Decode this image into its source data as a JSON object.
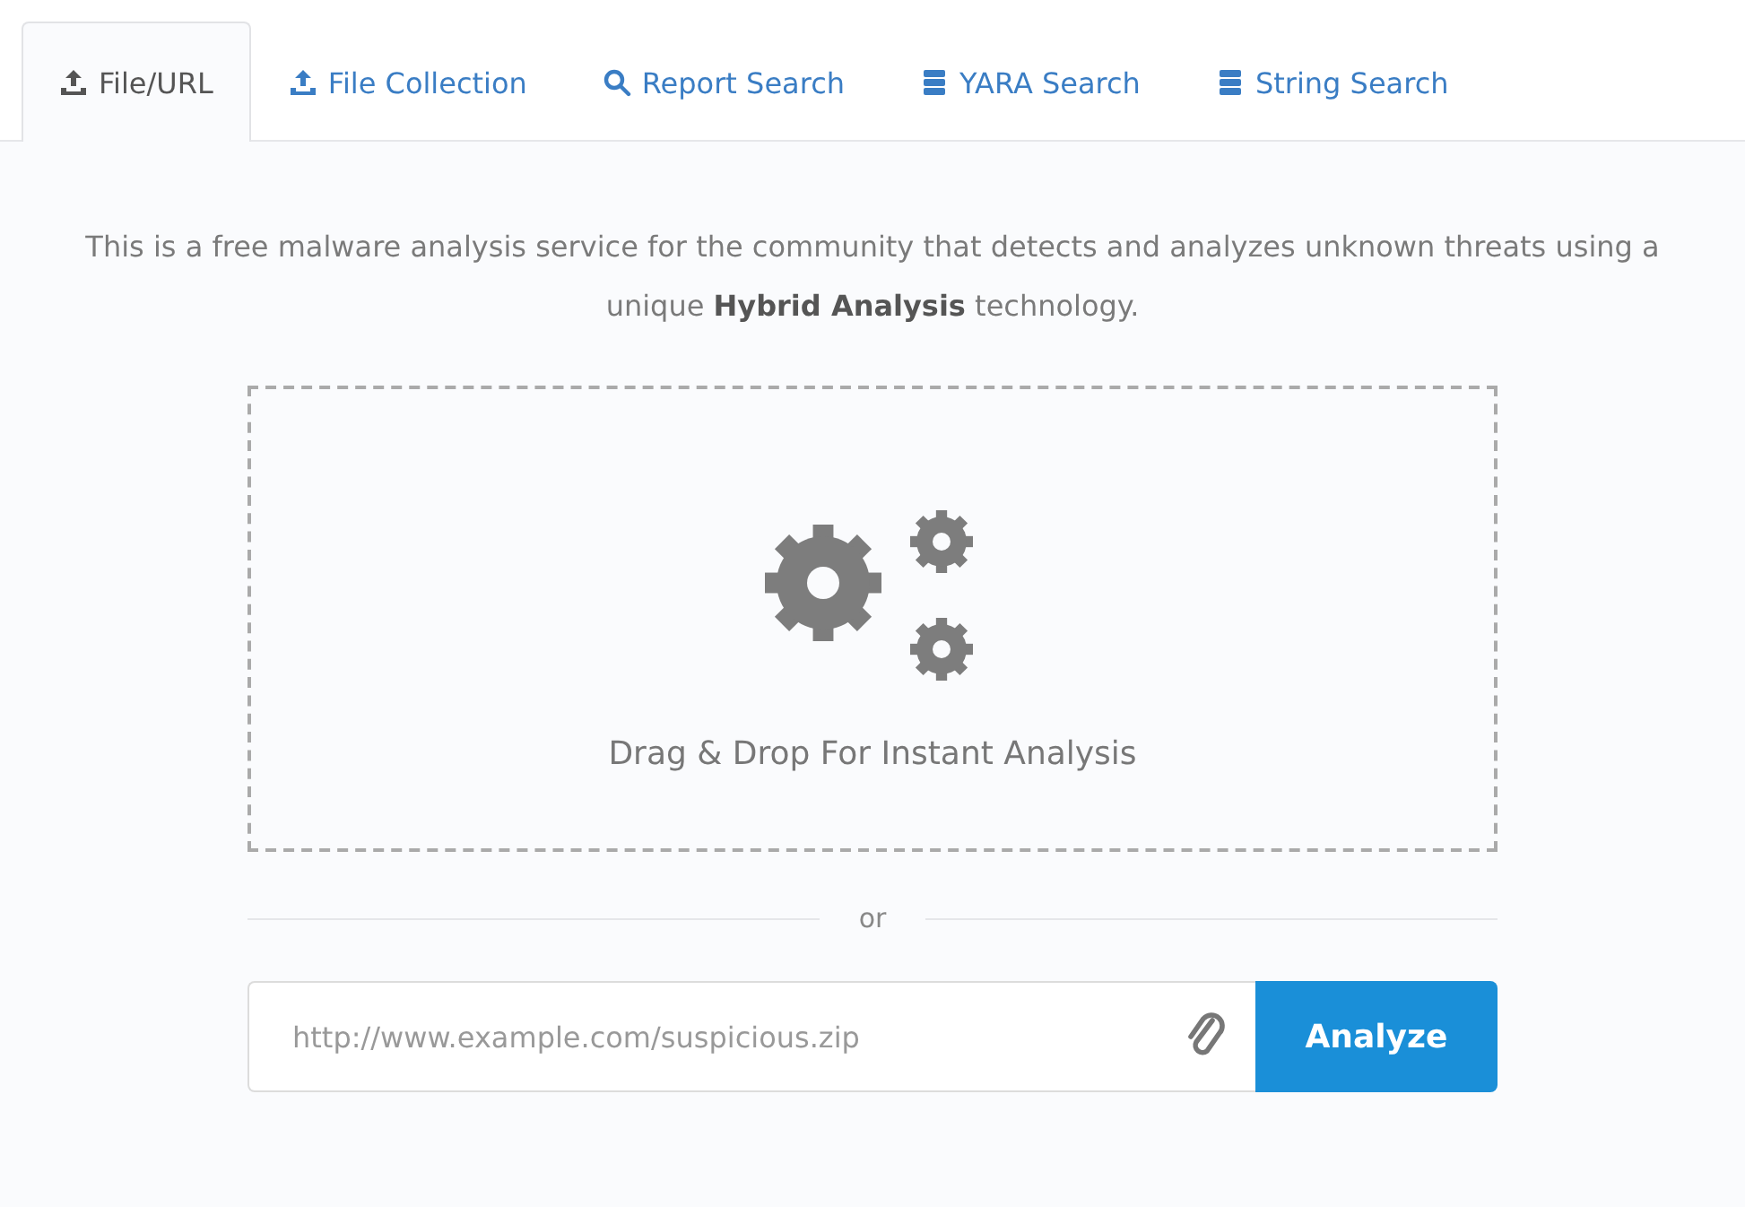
{
  "tabs": [
    {
      "label": "File/URL",
      "kind": "upload",
      "selected": true
    },
    {
      "label": "File Collection",
      "kind": "upload",
      "selected": false
    },
    {
      "label": "Report Search",
      "kind": "search",
      "selected": false
    },
    {
      "label": "YARA Search",
      "kind": "database",
      "selected": false
    },
    {
      "label": "String Search",
      "kind": "database",
      "selected": false
    }
  ],
  "intro": "This is a free malware analysis service for the community that detects and analyzes unknown threats using a unique **Hybrid Analysis** technology.",
  "dropzone": {
    "label": "Drag & Drop For Instant Analysis"
  },
  "divider": "or",
  "url_field": {
    "placeholder": "http://www.example.com/suspicious.zip"
  },
  "analyze_button": "Analyze"
}
